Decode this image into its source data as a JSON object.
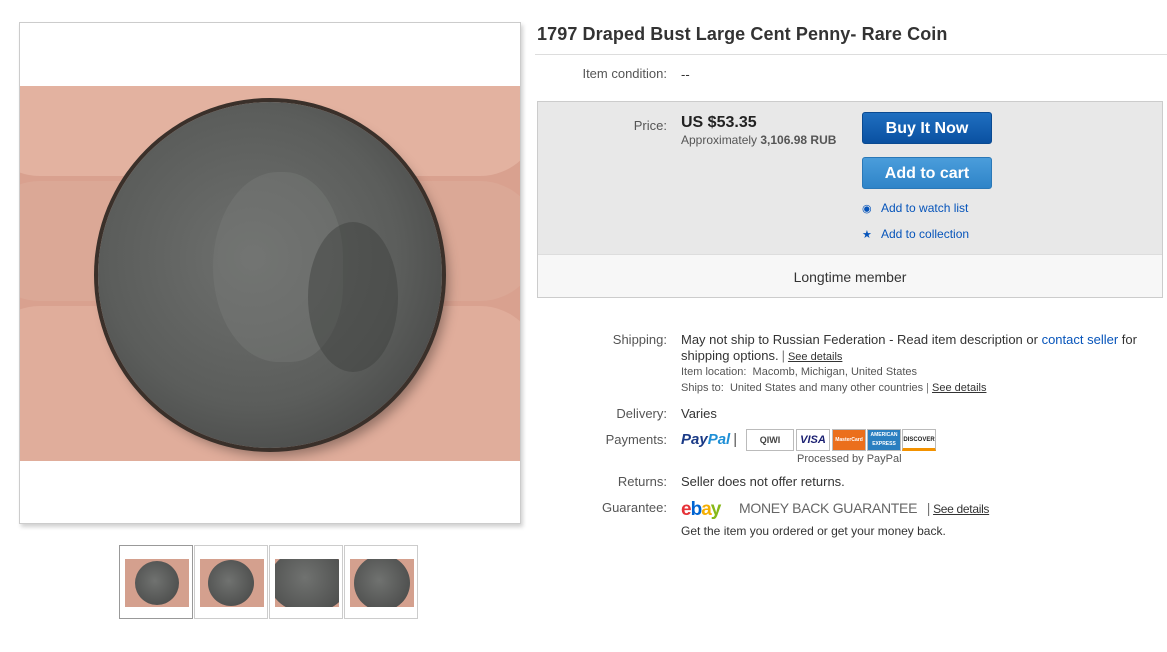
{
  "item": {
    "title": "1797 Draped Bust Large Cent Penny- Rare Coin",
    "condition_label": "Item condition:",
    "condition_value": "--"
  },
  "buybox": {
    "price_label": "Price:",
    "price": "US $53.35",
    "approx_prefix": "Approximately",
    "approx_value": "3,106.98 RUB",
    "buy_now": "Buy It Now",
    "add_to_cart": "Add to cart",
    "watch": "Add to watch list",
    "collection": "Add to collection",
    "footer": "Longtime member"
  },
  "shipping": {
    "label": "Shipping:",
    "text": "May not ship to Russian Federation - Read item description or",
    "contact": "contact seller",
    "for": "for",
    "options": "shipping options.",
    "see_details": "See details",
    "location_label": "Item location:",
    "location": "Macomb, Michigan, United States",
    "ships_to_label": "Ships to:",
    "ships_to": "United States and many other countries",
    "see_details2": "See details"
  },
  "delivery": {
    "label": "Delivery:",
    "value": "Varies"
  },
  "payments": {
    "label": "Payments:",
    "paypal_1": "Pay",
    "paypal_2": "Pal",
    "cards": [
      "QIWI",
      "VISA",
      "MasterCard",
      "AMERICAN EXPRESS",
      "DISCOVER"
    ],
    "processed": "Processed by PayPal"
  },
  "returns": {
    "label": "Returns:",
    "value": "Seller does not offer returns."
  },
  "guarantee": {
    "label": "Guarantee:",
    "logo": [
      "e",
      "b",
      "a",
      "y"
    ],
    "mbg": "MONEY BACK GUARANTEE",
    "see_details": "See details",
    "note": "Get the item you ordered or get your money back."
  },
  "colors": {
    "link": "#0654ba",
    "buy_button": "#0a51a1",
    "cart_button": "#2f84c8",
    "buybox_bg": "#e8e8e8"
  }
}
